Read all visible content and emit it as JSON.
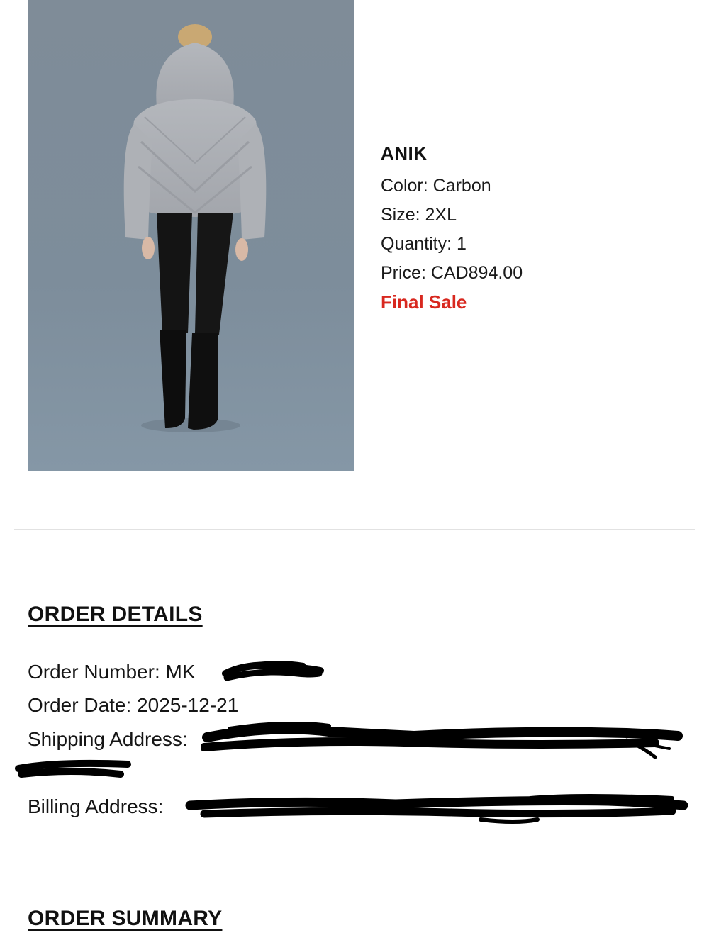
{
  "product": {
    "image_icon": "product-photo-fur-jacket",
    "name": "ANIK",
    "color": "Color: Carbon",
    "size": "Size: 2XL",
    "quantity": "Quantity: 1",
    "price": "Price: CAD894.00",
    "final_sale": "Final Sale"
  },
  "order_details": {
    "heading": "ORDER DETAILS",
    "order_number": "Order Number: MK",
    "order_date": "Order Date: 2025-12-21",
    "shipping_address": "Shipping Address:",
    "billing_address": "Billing Address:"
  },
  "order_summary": {
    "heading": "ORDER SUMMARY"
  },
  "colors": {
    "final_sale": "#d8281f",
    "photo_background": "#7e8e9c",
    "redaction": "#000000"
  }
}
